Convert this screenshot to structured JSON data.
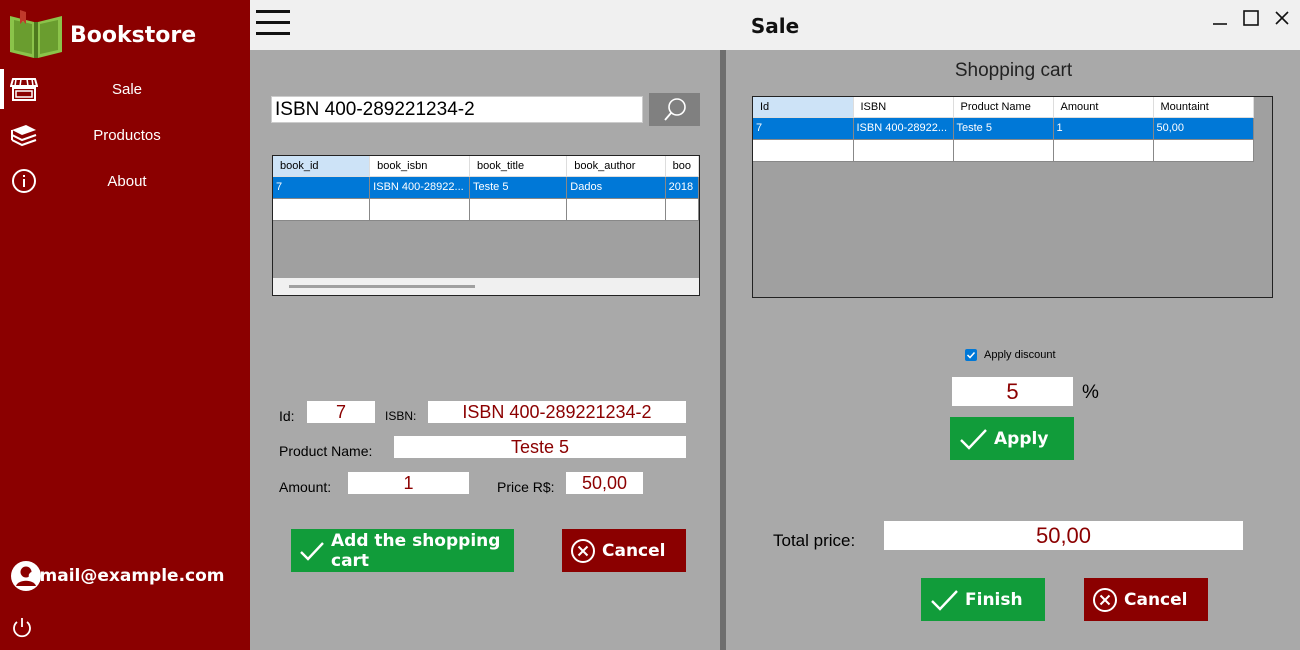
{
  "app": {
    "brand": "Bookstore",
    "title": "Sale"
  },
  "sidebar": {
    "items": [
      {
        "label": "Sale",
        "icon": "store-icon"
      },
      {
        "label": "Productos",
        "icon": "books-icon"
      },
      {
        "label": "About",
        "icon": "info-icon"
      }
    ],
    "user_email": "email@example.com"
  },
  "search": {
    "value": "ISBN 400-289221234-2"
  },
  "results_grid": {
    "columns": [
      "book_id",
      "book_isbn",
      "book_title",
      "book_author",
      "boo"
    ],
    "rows": [
      [
        "7",
        "ISBN 400-28922...",
        "Teste 5",
        "Dados",
        "2018"
      ]
    ]
  },
  "form": {
    "id_label": "Id:",
    "id_value": "7",
    "isbn_label": "ISBN:",
    "isbn_value": "ISBN 400-289221234-2",
    "name_label": "Product Name:",
    "name_value": "Teste 5",
    "amount_label": "Amount:",
    "amount_value": "1",
    "price_label": "Price R$:",
    "price_value": "50,00",
    "add_label": "Add the shopping cart",
    "cancel_label": "Cancel"
  },
  "cart": {
    "title": "Shopping cart",
    "columns": [
      "Id",
      "ISBN",
      "Product Name",
      "Amount",
      "Mountaint"
    ],
    "rows": [
      [
        "7",
        "ISBN 400-28922...",
        "Teste 5",
        "1",
        "50,00"
      ]
    ],
    "discount_label": "Apply discount",
    "discount_checked": true,
    "discount_value": "5",
    "percent_symbol": "%",
    "apply_label": "Apply",
    "total_label": "Total price:",
    "total_value": "50,00",
    "finish_label": "Finish",
    "cancel_label": "Cancel"
  },
  "colors": {
    "sidebar": "#8b0000",
    "accent_green": "#119c3a",
    "danger": "#8b0000",
    "selection": "#0078d7"
  }
}
